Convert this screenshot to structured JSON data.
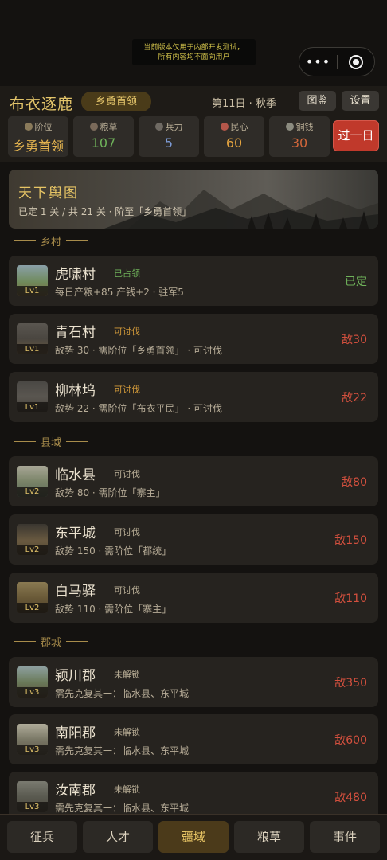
{
  "notice": {
    "line1": "当前版本仅用于内部开发测试，",
    "line2": "所有内容均不面向用户"
  },
  "capsule": {
    "more": "•••",
    "close_icon": "record-circle-icon"
  },
  "header": {
    "title": "布衣逐鹿",
    "rank_badge": "乡勇首领",
    "day": "第11日 · 秋季",
    "codex_label": "图鉴",
    "settings_label": "设置",
    "pass_day_label": "过一日"
  },
  "stats": [
    {
      "label": "阶位",
      "value": "乡勇首领",
      "color": "#e3b34f",
      "icon": "rank-icon"
    },
    {
      "label": "粮草",
      "value": "107",
      "color": "#6fb25a",
      "icon": "grain-icon"
    },
    {
      "label": "兵力",
      "value": "5",
      "color": "#7d9bd6",
      "icon": "troops-icon"
    },
    {
      "label": "民心",
      "value": "60",
      "color": "#e7a640",
      "icon": "heart-icon"
    },
    {
      "label": "铜钱",
      "value": "30",
      "color": "#d2663a",
      "icon": "coin-icon"
    }
  ],
  "map": {
    "title": "天下舆图",
    "subtitle": "已定 1 关 / 共 21 关 · 阶至「乡勇首领」"
  },
  "sections": {
    "village": "乡村",
    "county": "县域",
    "prefecture": "郡城"
  },
  "cards": [
    {
      "name": "虎啸村",
      "tag": "已占领",
      "tag_color": "#6fb25a",
      "desc": "每日产粮+85 产钱+2 · 驻军5",
      "right": "已定",
      "right_color": "#6fb25a",
      "level": "Lv1"
    },
    {
      "name": "青石村",
      "tag": "可讨伐",
      "tag_color": "#d29a3a",
      "desc": "敌势 30 · 需阶位「乡勇首领」 · 可讨伐",
      "right": "敌30",
      "right_color": "#d4503e",
      "level": "Lv1"
    },
    {
      "name": "柳林坞",
      "tag": "可讨伐",
      "tag_color": "#d29a3a",
      "desc": "敌势 22 · 需阶位「布衣平民」 · 可讨伐",
      "right": "敌22",
      "right_color": "#d4503e",
      "level": "Lv1"
    },
    {
      "name": "临水县",
      "tag": "可讨伐",
      "tag_color": "#b9ae96",
      "desc": "敌势 80 · 需阶位「寨主」",
      "right": "敌80",
      "right_color": "#d4503e",
      "level": "Lv2"
    },
    {
      "name": "东平城",
      "tag": "可讨伐",
      "tag_color": "#b9ae96",
      "desc": "敌势 150 · 需阶位「都统」",
      "right": "敌150",
      "right_color": "#d4503e",
      "level": "Lv2"
    },
    {
      "name": "白马驿",
      "tag": "可讨伐",
      "tag_color": "#b9ae96",
      "desc": "敌势 110 · 需阶位「寨主」",
      "right": "敌110",
      "right_color": "#d4503e",
      "level": "Lv2"
    },
    {
      "name": "颍川郡",
      "tag": "未解锁",
      "tag_color": "#b9ae96",
      "desc": "需先克复其一：临水县、东平城",
      "right": "敌350",
      "right_color": "#d4503e",
      "level": "Lv3"
    },
    {
      "name": "南阳郡",
      "tag": "未解锁",
      "tag_color": "#b9ae96",
      "desc": "需先克复其一：临水县、东平城",
      "right": "敌600",
      "right_color": "#d4503e",
      "level": "Lv3"
    },
    {
      "name": "汝南郡",
      "tag": "未解锁",
      "tag_color": "#b9ae96",
      "desc": "需先克复其一：临水县、东平城",
      "right": "敌480",
      "right_color": "#d4503e",
      "level": "Lv3"
    }
  ],
  "nav": [
    {
      "label": "征兵",
      "active": false
    },
    {
      "label": "人才",
      "active": false
    },
    {
      "label": "疆域",
      "active": true
    },
    {
      "label": "粮草",
      "active": false
    },
    {
      "label": "事件",
      "active": false
    }
  ]
}
